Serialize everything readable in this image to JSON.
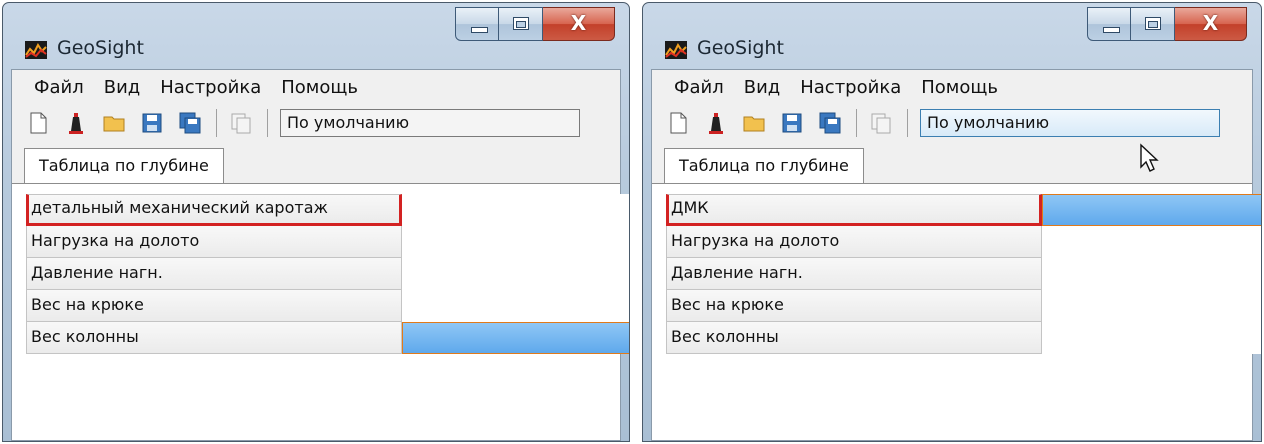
{
  "colors": {
    "highlight_border": "#d32222",
    "selection_fill": "#5fa9ec",
    "selection_border": "#e07a1a"
  },
  "windows": [
    {
      "title": "GeoSight",
      "menu": [
        "Файл",
        "Вид",
        "Настройка",
        "Помощь"
      ],
      "toolbar": {
        "icons": [
          "new-file-icon",
          "tower-icon",
          "open-folder-icon",
          "save-icon",
          "save-all-icon",
          "copy-icon"
        ],
        "profile_value": "По умолчанию"
      },
      "tab": "Таблица по глубине",
      "rows": [
        {
          "name": "детальный механический каротаж",
          "highlighted": true,
          "selected": false
        },
        {
          "name": "Нагрузка на долото",
          "highlighted": false,
          "selected": false
        },
        {
          "name": "Давление нагн.",
          "highlighted": false,
          "selected": false
        },
        {
          "name": "Вес на крюке",
          "highlighted": false,
          "selected": false
        },
        {
          "name": "Вес колонны",
          "highlighted": false,
          "selected": true
        }
      ]
    },
    {
      "title": "GeoSight",
      "menu": [
        "Файл",
        "Вид",
        "Настройка",
        "Помощь"
      ],
      "toolbar": {
        "icons": [
          "new-file-icon",
          "tower-icon",
          "open-folder-icon",
          "save-icon",
          "save-all-icon",
          "copy-icon"
        ],
        "profile_value": "По умолчанию"
      },
      "tab": "Таблица по глубине",
      "rows": [
        {
          "name": "ДМК",
          "highlighted": true,
          "selected": true
        },
        {
          "name": "Нагрузка на долото",
          "highlighted": false,
          "selected": false
        },
        {
          "name": "Давление нагн.",
          "highlighted": false,
          "selected": false
        },
        {
          "name": "Вес на крюке",
          "highlighted": false,
          "selected": false
        },
        {
          "name": "Вес колонны",
          "highlighted": false,
          "selected": false
        }
      ]
    }
  ]
}
